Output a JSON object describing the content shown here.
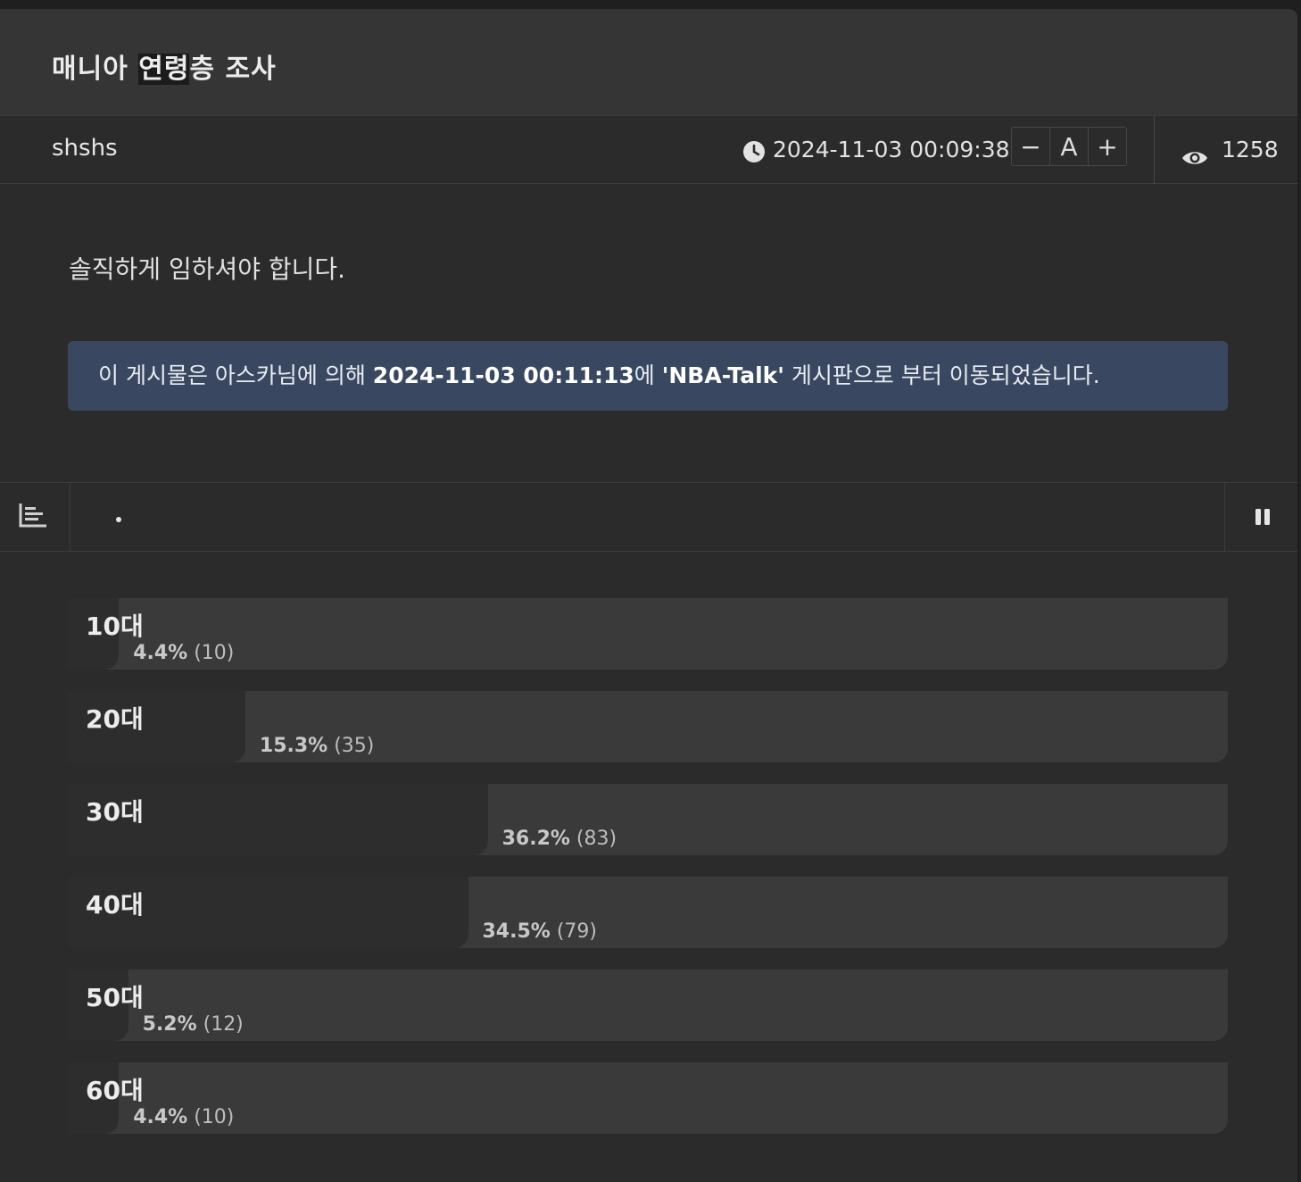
{
  "post": {
    "title_part1": "매니아 ",
    "title_highlight": "연령",
    "title_part2": "층 조사",
    "author": "shshs",
    "datetime": "2024-11-03 00:09:38",
    "views": "1258",
    "body": "솔직하게 임하셔야 합니다."
  },
  "font_controls": {
    "decrease": "−",
    "reset": "A",
    "increase": "+"
  },
  "notice": {
    "prefix": "이 게시물은 아스카님에 의해 ",
    "moved_at": "2024-11-03 00:11:13",
    "mid": "에 ",
    "board": "'NBA-Talk'",
    "suffix": " 게시판으로 부터 이동되었습니다."
  },
  "toolbar": {
    "left_icon": "bar-chart-icon",
    "right_icon": "pause-icon"
  },
  "icons": {
    "datetime": "clock-icon",
    "views": "eye-icon"
  },
  "poll": {
    "options": [
      {
        "label": "10대",
        "percent": 4.4,
        "percent_text": "4.4%",
        "count_text": "(10)"
      },
      {
        "label": "20대",
        "percent": 15.3,
        "percent_text": "15.3%",
        "count_text": "(35)"
      },
      {
        "label": "30대",
        "percent": 36.2,
        "percent_text": "36.2%",
        "count_text": "(83)"
      },
      {
        "label": "40대",
        "percent": 34.5,
        "percent_text": "34.5%",
        "count_text": "(79)"
      },
      {
        "label": "50대",
        "percent": 5.2,
        "percent_text": "5.2%",
        "count_text": "(12)"
      },
      {
        "label": "60대",
        "percent": 4.4,
        "percent_text": "4.4%",
        "count_text": "(10)"
      }
    ]
  },
  "colors": {
    "background": "#2b2b2b",
    "title_bar": "#353535",
    "notice_bg": "#394860",
    "poll_track": "#3a3a3a",
    "poll_fill": "#2d2d2d"
  }
}
